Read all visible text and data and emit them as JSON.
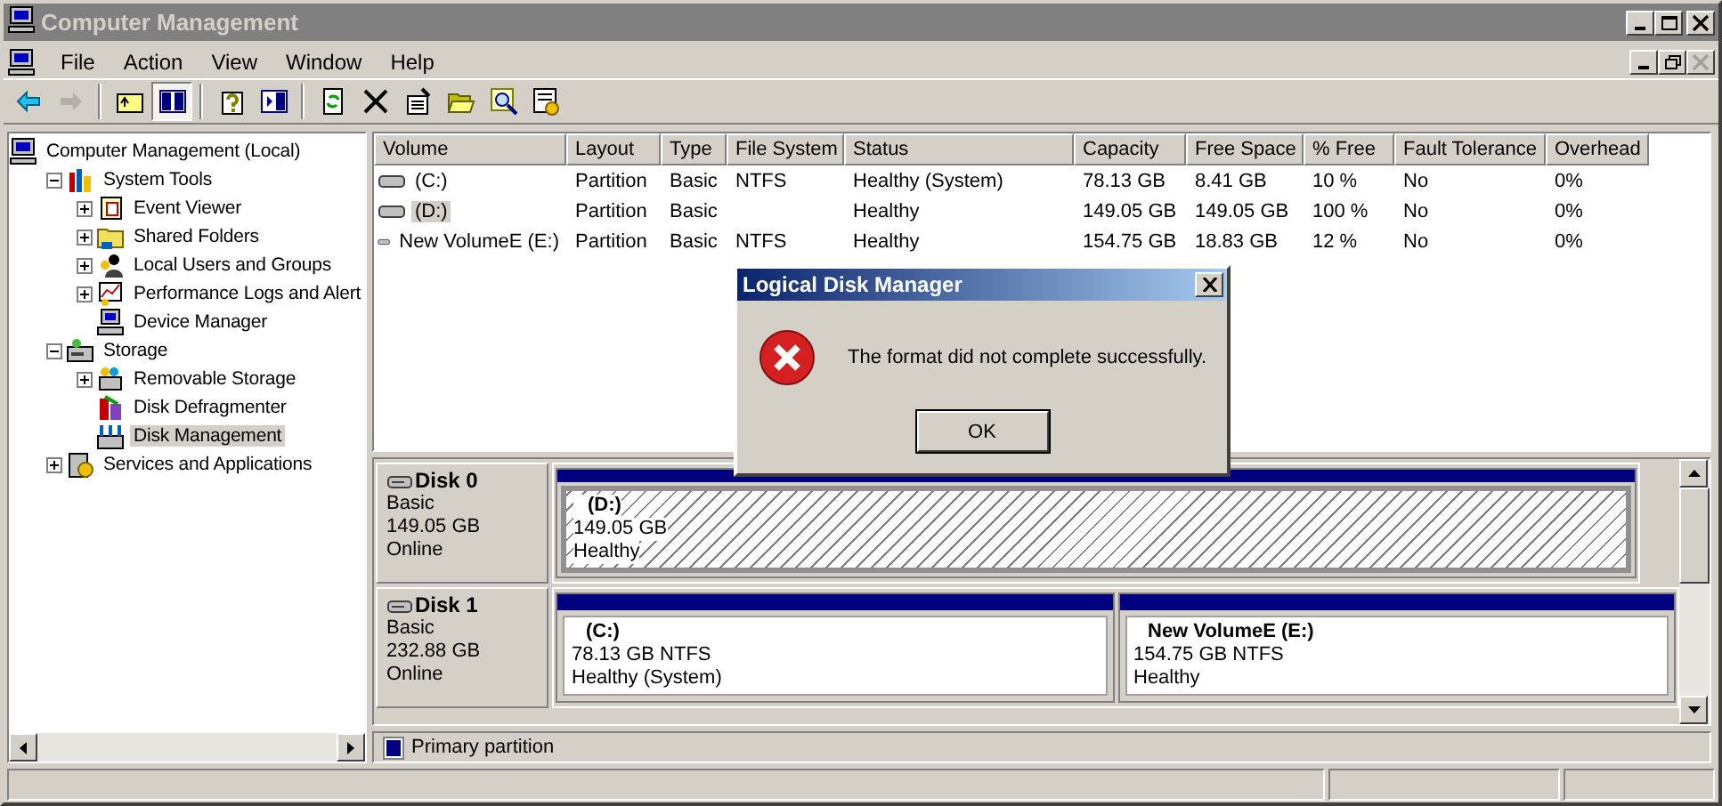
{
  "window": {
    "title": "Computer Management"
  },
  "menu": [
    "File",
    "Action",
    "View",
    "Window",
    "Help"
  ],
  "toolbar": [
    [
      {
        "kind": "back",
        "disabled": false,
        "pressed": false
      },
      {
        "kind": "forward",
        "disabled": true,
        "pressed": false
      }
    ],
    [
      {
        "kind": "up",
        "disabled": false,
        "pressed": false
      },
      {
        "kind": "tree",
        "disabled": false,
        "pressed": true
      }
    ],
    [
      {
        "kind": "help",
        "disabled": false,
        "pressed": false
      },
      {
        "kind": "panel",
        "disabled": false,
        "pressed": false
      }
    ],
    [
      {
        "kind": "refresh",
        "disabled": false,
        "pressed": false
      },
      {
        "kind": "delete",
        "disabled": false,
        "pressed": false
      },
      {
        "kind": "properties",
        "disabled": false,
        "pressed": false
      },
      {
        "kind": "open",
        "disabled": false,
        "pressed": false
      },
      {
        "kind": "find",
        "disabled": false,
        "pressed": false
      },
      {
        "kind": "settings",
        "disabled": false,
        "pressed": false
      }
    ]
  ],
  "tree": [
    {
      "label": "Computer Management (Local)",
      "kind": "root",
      "selected": false,
      "children": [
        {
          "label": "System Tools",
          "kind": "branch",
          "expanded": true,
          "selected": false,
          "children": [
            {
              "label": "Event Viewer",
              "kind": "branch",
              "expanded": false,
              "selected": false
            },
            {
              "label": "Shared Folders",
              "kind": "branch",
              "expanded": false,
              "selected": false
            },
            {
              "label": "Local Users and Groups",
              "kind": "branch",
              "expanded": false,
              "selected": false
            },
            {
              "label": "Performance Logs and Alert",
              "kind": "branch",
              "expanded": false,
              "selected": false
            },
            {
              "label": "Device Manager",
              "kind": "leaf",
              "selected": false
            }
          ]
        },
        {
          "label": "Storage",
          "kind": "branch",
          "expanded": true,
          "selected": false,
          "children": [
            {
              "label": "Removable Storage",
              "kind": "branch",
              "expanded": false,
              "selected": false
            },
            {
              "label": "Disk Defragmenter",
              "kind": "leaf",
              "selected": false
            },
            {
              "label": "Disk Management",
              "kind": "leaf",
              "selected": true
            }
          ]
        },
        {
          "label": "Services and Applications",
          "kind": "branch",
          "expanded": false,
          "selected": false
        }
      ]
    }
  ],
  "table": {
    "columns": [
      "Volume",
      "Layout",
      "Type",
      "File System",
      "Status",
      "Capacity",
      "Free Space",
      "% Free",
      "Fault Tolerance",
      "Overhead"
    ],
    "rows": [
      {
        "selected": false,
        "cells": [
          "(C:)",
          "Partition",
          "Basic",
          "NTFS",
          "Healthy (System)",
          "78.13 GB",
          "8.41 GB",
          "10 %",
          "No",
          "0%"
        ]
      },
      {
        "selected": true,
        "cells": [
          "(D:)",
          "Partition",
          "Basic",
          "",
          "Healthy",
          "149.05 GB",
          "149.05 GB",
          "100 %",
          "No",
          "0%"
        ]
      },
      {
        "selected": false,
        "cells": [
          "New VolumeE (E:)",
          "Partition",
          "Basic",
          "NTFS",
          "Healthy",
          "154.75 GB",
          "18.83 GB",
          "12 %",
          "No",
          "0%"
        ]
      }
    ]
  },
  "disks": [
    {
      "name": "Disk 0",
      "type": "Basic",
      "size": "149.05 GB",
      "status": "Online",
      "partitions": [
        {
          "title": "(D:)",
          "detail": "149.05 GB",
          "status": "Healthy",
          "selected": true
        }
      ]
    },
    {
      "name": "Disk 1",
      "type": "Basic",
      "size": "232.88 GB",
      "status": "Online",
      "partitions": [
        {
          "title": "(C:)",
          "detail": "78.13 GB NTFS",
          "status": "Healthy (System)",
          "selected": false
        },
        {
          "title": "New VolumeE  (E:)",
          "detail": "154.75 GB NTFS",
          "status": "Healthy",
          "selected": false
        }
      ]
    }
  ],
  "legend": [
    {
      "label": "Primary partition",
      "color": "#000080"
    }
  ],
  "dialog": {
    "title": "Logical Disk Manager",
    "message": "The format did not complete successfully.",
    "button": "OK"
  }
}
